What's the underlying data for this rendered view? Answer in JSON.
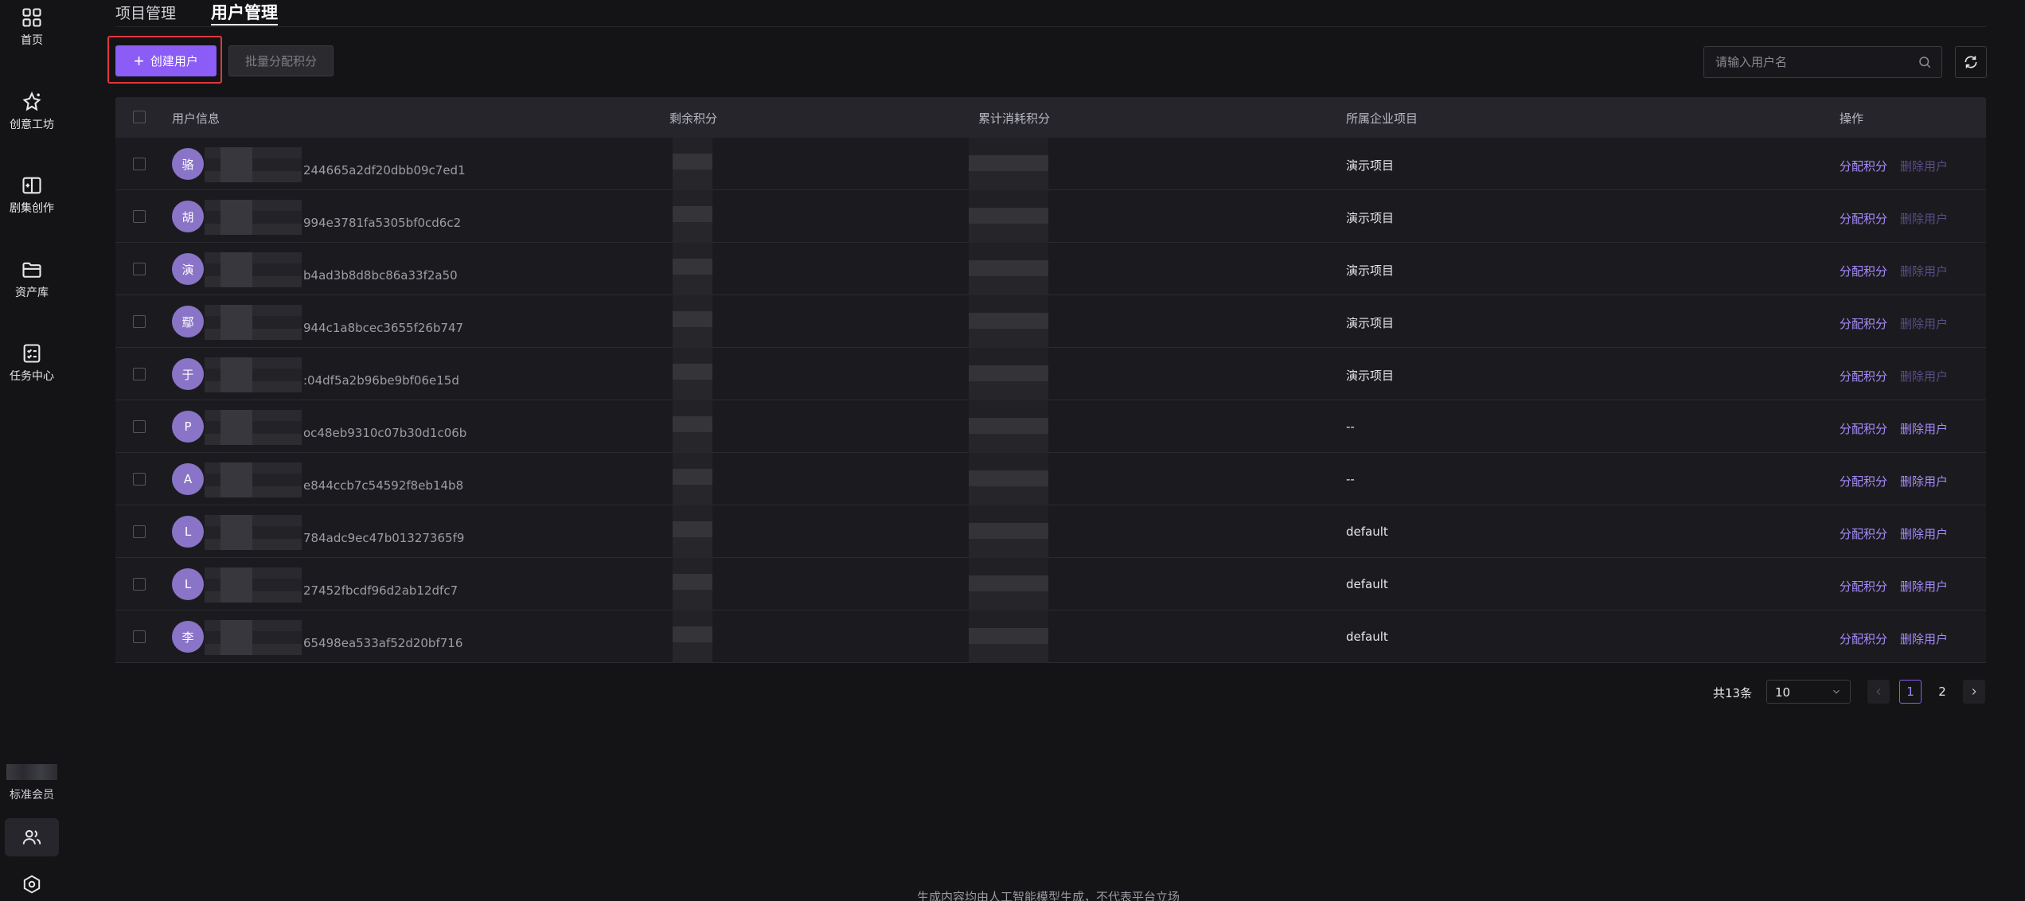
{
  "colors": {
    "accent": "#8b5cf6",
    "link": "#a78bfa",
    "background": "#141417",
    "highlight_outline": "#e0383e"
  },
  "sidebar": {
    "items": [
      {
        "label": "首页",
        "icon": "grid-icon"
      },
      {
        "label": "创意工坊",
        "icon": "sparkle-star-icon"
      },
      {
        "label": "剧集创作",
        "icon": "book-plus-icon"
      },
      {
        "label": "资产库",
        "icon": "folder-icon"
      },
      {
        "label": "任务中心",
        "icon": "task-checklist-icon"
      }
    ],
    "member_label": "标准会员",
    "bottom_icons": [
      "users-icon",
      "settings-hexagon-icon"
    ]
  },
  "tabs": [
    {
      "label": "项目管理",
      "active": false
    },
    {
      "label": "用户管理",
      "active": true
    }
  ],
  "toolbar": {
    "create_label": "创建用户",
    "batch_label": "批量分配积分",
    "search_placeholder": "请输入用户名"
  },
  "table": {
    "columns": [
      "用户信息",
      "剩余积分",
      "累计消耗积分",
      "所属企业项目",
      "操作"
    ],
    "action_assign": "分配积分",
    "action_delete": "删除用户",
    "rows": [
      {
        "avatar": "骆",
        "id_suffix": "244665a2df20dbb09c7ed1",
        "project": "演示项目",
        "delete_enabled": false
      },
      {
        "avatar": "胡",
        "id_suffix": "994e3781fa5305bf0cd6c2",
        "project": "演示项目",
        "delete_enabled": false
      },
      {
        "avatar": "演",
        "id_suffix": "b4ad3b8d8bc86a33f2a50",
        "project": "演示项目",
        "delete_enabled": false
      },
      {
        "avatar": "鄢",
        "id_suffix": "944c1a8bcec3655f26b747",
        "project": "演示项目",
        "delete_enabled": false
      },
      {
        "avatar": "于",
        "id_suffix": ":04df5a2b96be9bf06e15d",
        "project": "演示项目",
        "delete_enabled": false
      },
      {
        "avatar": "P",
        "id_suffix": "oc48eb9310c07b30d1c06b",
        "project": "--",
        "delete_enabled": true
      },
      {
        "avatar": "A",
        "id_suffix": "e844ccb7c54592f8eb14b8",
        "project": "--",
        "delete_enabled": true
      },
      {
        "avatar": "L",
        "id_suffix": "784adc9ec47b01327365f9",
        "project": "default",
        "delete_enabled": true
      },
      {
        "avatar": "L",
        "id_suffix": "27452fbcdf96d2ab12dfc7",
        "project": "default",
        "delete_enabled": true
      },
      {
        "avatar": "李",
        "id_suffix": "65498ea533af52d20bf716",
        "project": "default",
        "delete_enabled": true
      }
    ]
  },
  "pagination": {
    "total_label": "共13条",
    "page_size": "10",
    "pages": [
      "1",
      "2"
    ],
    "current_page": "1"
  },
  "footer": {
    "text": "生成内容均由人工智能模型生成，不代表平台立场"
  }
}
